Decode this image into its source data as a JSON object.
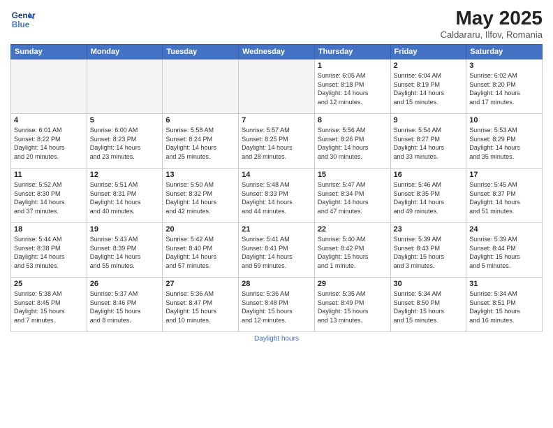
{
  "header": {
    "logo_line1": "General",
    "logo_line2": "Blue",
    "month": "May 2025",
    "location": "Caldararu, Ilfov, Romania"
  },
  "weekdays": [
    "Sunday",
    "Monday",
    "Tuesday",
    "Wednesday",
    "Thursday",
    "Friday",
    "Saturday"
  ],
  "weeks": [
    [
      {
        "day": "",
        "info": ""
      },
      {
        "day": "",
        "info": ""
      },
      {
        "day": "",
        "info": ""
      },
      {
        "day": "",
        "info": ""
      },
      {
        "day": "1",
        "info": "Sunrise: 6:05 AM\nSunset: 8:18 PM\nDaylight: 14 hours\nand 12 minutes."
      },
      {
        "day": "2",
        "info": "Sunrise: 6:04 AM\nSunset: 8:19 PM\nDaylight: 14 hours\nand 15 minutes."
      },
      {
        "day": "3",
        "info": "Sunrise: 6:02 AM\nSunset: 8:20 PM\nDaylight: 14 hours\nand 17 minutes."
      }
    ],
    [
      {
        "day": "4",
        "info": "Sunrise: 6:01 AM\nSunset: 8:22 PM\nDaylight: 14 hours\nand 20 minutes."
      },
      {
        "day": "5",
        "info": "Sunrise: 6:00 AM\nSunset: 8:23 PM\nDaylight: 14 hours\nand 23 minutes."
      },
      {
        "day": "6",
        "info": "Sunrise: 5:58 AM\nSunset: 8:24 PM\nDaylight: 14 hours\nand 25 minutes."
      },
      {
        "day": "7",
        "info": "Sunrise: 5:57 AM\nSunset: 8:25 PM\nDaylight: 14 hours\nand 28 minutes."
      },
      {
        "day": "8",
        "info": "Sunrise: 5:56 AM\nSunset: 8:26 PM\nDaylight: 14 hours\nand 30 minutes."
      },
      {
        "day": "9",
        "info": "Sunrise: 5:54 AM\nSunset: 8:27 PM\nDaylight: 14 hours\nand 33 minutes."
      },
      {
        "day": "10",
        "info": "Sunrise: 5:53 AM\nSunset: 8:29 PM\nDaylight: 14 hours\nand 35 minutes."
      }
    ],
    [
      {
        "day": "11",
        "info": "Sunrise: 5:52 AM\nSunset: 8:30 PM\nDaylight: 14 hours\nand 37 minutes."
      },
      {
        "day": "12",
        "info": "Sunrise: 5:51 AM\nSunset: 8:31 PM\nDaylight: 14 hours\nand 40 minutes."
      },
      {
        "day": "13",
        "info": "Sunrise: 5:50 AM\nSunset: 8:32 PM\nDaylight: 14 hours\nand 42 minutes."
      },
      {
        "day": "14",
        "info": "Sunrise: 5:48 AM\nSunset: 8:33 PM\nDaylight: 14 hours\nand 44 minutes."
      },
      {
        "day": "15",
        "info": "Sunrise: 5:47 AM\nSunset: 8:34 PM\nDaylight: 14 hours\nand 47 minutes."
      },
      {
        "day": "16",
        "info": "Sunrise: 5:46 AM\nSunset: 8:35 PM\nDaylight: 14 hours\nand 49 minutes."
      },
      {
        "day": "17",
        "info": "Sunrise: 5:45 AM\nSunset: 8:37 PM\nDaylight: 14 hours\nand 51 minutes."
      }
    ],
    [
      {
        "day": "18",
        "info": "Sunrise: 5:44 AM\nSunset: 8:38 PM\nDaylight: 14 hours\nand 53 minutes."
      },
      {
        "day": "19",
        "info": "Sunrise: 5:43 AM\nSunset: 8:39 PM\nDaylight: 14 hours\nand 55 minutes."
      },
      {
        "day": "20",
        "info": "Sunrise: 5:42 AM\nSunset: 8:40 PM\nDaylight: 14 hours\nand 57 minutes."
      },
      {
        "day": "21",
        "info": "Sunrise: 5:41 AM\nSunset: 8:41 PM\nDaylight: 14 hours\nand 59 minutes."
      },
      {
        "day": "22",
        "info": "Sunrise: 5:40 AM\nSunset: 8:42 PM\nDaylight: 15 hours\nand 1 minute."
      },
      {
        "day": "23",
        "info": "Sunrise: 5:39 AM\nSunset: 8:43 PM\nDaylight: 15 hours\nand 3 minutes."
      },
      {
        "day": "24",
        "info": "Sunrise: 5:39 AM\nSunset: 8:44 PM\nDaylight: 15 hours\nand 5 minutes."
      }
    ],
    [
      {
        "day": "25",
        "info": "Sunrise: 5:38 AM\nSunset: 8:45 PM\nDaylight: 15 hours\nand 7 minutes."
      },
      {
        "day": "26",
        "info": "Sunrise: 5:37 AM\nSunset: 8:46 PM\nDaylight: 15 hours\nand 8 minutes."
      },
      {
        "day": "27",
        "info": "Sunrise: 5:36 AM\nSunset: 8:47 PM\nDaylight: 15 hours\nand 10 minutes."
      },
      {
        "day": "28",
        "info": "Sunrise: 5:36 AM\nSunset: 8:48 PM\nDaylight: 15 hours\nand 12 minutes."
      },
      {
        "day": "29",
        "info": "Sunrise: 5:35 AM\nSunset: 8:49 PM\nDaylight: 15 hours\nand 13 minutes."
      },
      {
        "day": "30",
        "info": "Sunrise: 5:34 AM\nSunset: 8:50 PM\nDaylight: 15 hours\nand 15 minutes."
      },
      {
        "day": "31",
        "info": "Sunrise: 5:34 AM\nSunset: 8:51 PM\nDaylight: 15 hours\nand 16 minutes."
      }
    ]
  ],
  "footer": {
    "label": "Daylight hours"
  }
}
